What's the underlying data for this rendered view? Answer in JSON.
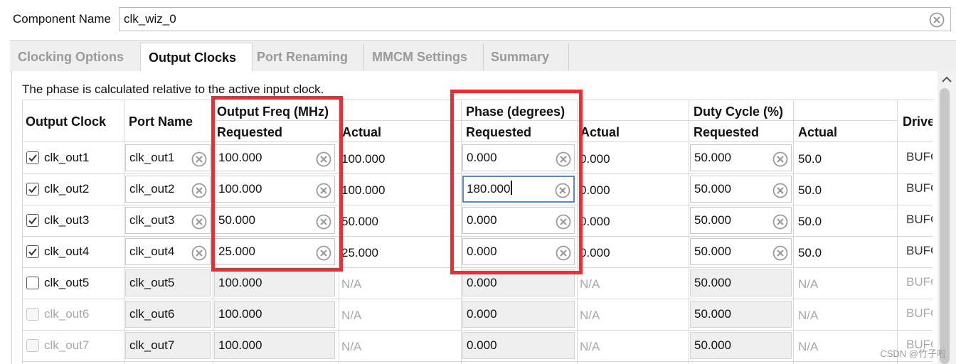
{
  "component": {
    "label": "Component Name",
    "value": "clk_wiz_0"
  },
  "tabs": [
    {
      "label": "Clocking Options",
      "active": false
    },
    {
      "label": "Output Clocks",
      "active": true
    },
    {
      "label": "Port Renaming",
      "active": false
    },
    {
      "label": "MMCM Settings",
      "active": false
    },
    {
      "label": "Summary",
      "active": false
    }
  ],
  "info_text": "The phase is calculated relative to the active input clock.",
  "table": {
    "headers": {
      "output_clock": "Output Clock",
      "port_name": "Port Name",
      "output_freq": "Output Freq (MHz)",
      "phase": "Phase (degrees)",
      "duty_cycle": "Duty Cycle (%)",
      "requested": "Requested",
      "actual": "Actual",
      "drives": "Drive"
    },
    "rows": [
      {
        "name": "clk_out1",
        "checked": true,
        "enabled": true,
        "port": "clk_out1",
        "freq_req": "100.000",
        "freq_act": "100.000",
        "phase_req": "0.000",
        "phase_act": "0.000",
        "duty_req": "50.000",
        "duty_act": "50.0",
        "drive": "BUFG"
      },
      {
        "name": "clk_out2",
        "checked": true,
        "enabled": true,
        "port": "clk_out2",
        "freq_req": "100.000",
        "freq_act": "100.000",
        "phase_req": "180.000",
        "phase_act": "0.000",
        "duty_req": "50.000",
        "duty_act": "50.0",
        "drive": "BUFG"
      },
      {
        "name": "clk_out3",
        "checked": true,
        "enabled": true,
        "port": "clk_out3",
        "freq_req": "50.000",
        "freq_act": "50.000",
        "phase_req": "0.000",
        "phase_act": "0.000",
        "duty_req": "50.000",
        "duty_act": "50.0",
        "drive": "BUFG"
      },
      {
        "name": "clk_out4",
        "checked": true,
        "enabled": true,
        "port": "clk_out4",
        "freq_req": "25.000",
        "freq_act": "25.000",
        "phase_req": "0.000",
        "phase_act": "0.000",
        "duty_req": "50.000",
        "duty_act": "50.0",
        "drive": "BUFG"
      },
      {
        "name": "clk_out5",
        "checked": false,
        "enabled": true,
        "port": "clk_out5",
        "freq_req": "100.000",
        "freq_act": "N/A",
        "phase_req": "0.000",
        "phase_act": "N/A",
        "duty_req": "50.000",
        "duty_act": "N/A",
        "drive": "BUFG"
      },
      {
        "name": "clk_out6",
        "checked": false,
        "enabled": false,
        "port": "clk_out6",
        "freq_req": "100.000",
        "freq_act": "N/A",
        "phase_req": "0.000",
        "phase_act": "N/A",
        "duty_req": "50.000",
        "duty_act": "N/A",
        "drive": "BUFG"
      },
      {
        "name": "clk_out7",
        "checked": false,
        "enabled": false,
        "port": "clk_out7",
        "freq_req": "100.000",
        "freq_act": "N/A",
        "phase_req": "0.000",
        "phase_act": "N/A",
        "duty_req": "50.000",
        "duty_act": "N/A",
        "drive": "BUFG"
      }
    ]
  },
  "focused": {
    "row": 1,
    "field": "phase_req"
  },
  "watermark": "CSDN @竹子啦",
  "colors": {
    "highlight": "#ee2d33",
    "focus": "#5b88c9",
    "tab_inactive": "#9a9a9a"
  },
  "icons": {
    "clear": "clear-circle-x-icon",
    "check": "check-icon",
    "scroll_up": "chevron-up-icon"
  }
}
